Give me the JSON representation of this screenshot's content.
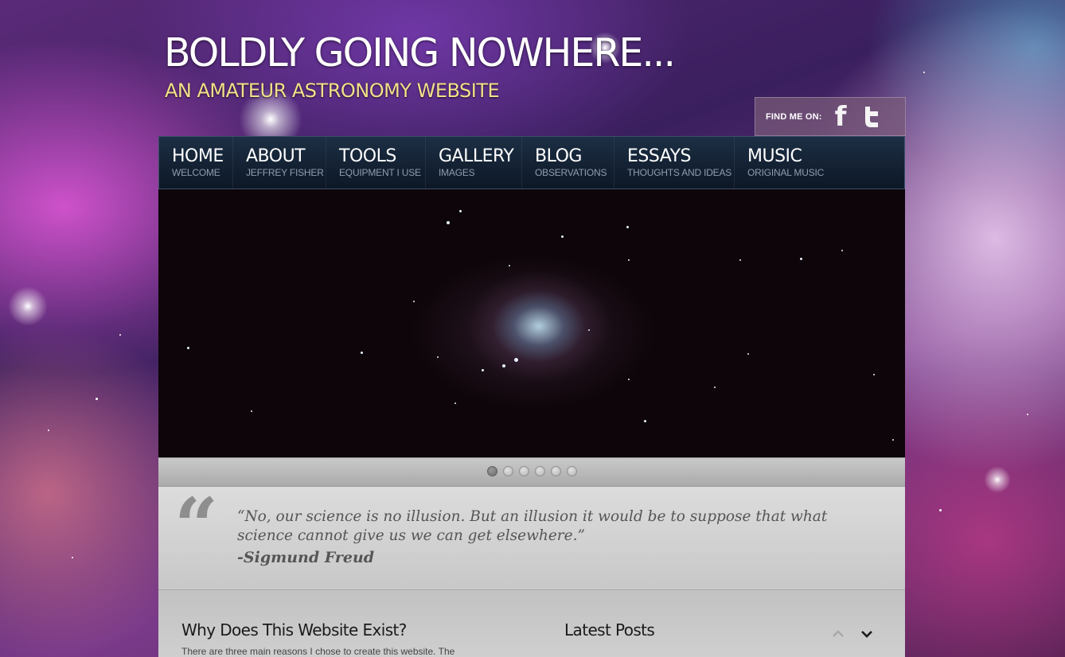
{
  "header": {
    "title": "BOLDLY GOING NOWHERE...",
    "subtitle": "AN AMATEUR ASTRONOMY WEBSITE"
  },
  "social": {
    "label": "FIND ME ON:",
    "facebook_glyph": "f",
    "icons": [
      "facebook-icon",
      "twitter-icon"
    ]
  },
  "nav": {
    "items": [
      {
        "label": "HOME",
        "sub": "WELCOME"
      },
      {
        "label": "ABOUT",
        "sub": "JEFFREY FISHER"
      },
      {
        "label": "TOOLS",
        "sub": "EQUIPMENT I USE"
      },
      {
        "label": "GALLERY",
        "sub": "IMAGES"
      },
      {
        "label": "BLOG",
        "sub": "OBSERVATIONS"
      },
      {
        "label": "ESSAYS",
        "sub": "THOUGHTS AND IDEAS"
      },
      {
        "label": "MUSIC",
        "sub": "ORIGINAL MUSIC"
      }
    ]
  },
  "slider": {
    "slide_count": 6,
    "active_index": 0
  },
  "quote": {
    "mark": "“",
    "text": "“No, our science is no illusion. But an illusion it would be to suppose that what science cannot give us we can get elsewhere.”",
    "author": "-Sigmund Freud"
  },
  "content": {
    "why_title": "Why Does This Website Exist?",
    "why_body": "There are three main reasons I chose to create this website. The",
    "latest_title": "Latest Posts"
  },
  "colors": {
    "nav_bg": "#10202f",
    "subtitle": "#f2e08a",
    "quote_text": "#555555"
  }
}
